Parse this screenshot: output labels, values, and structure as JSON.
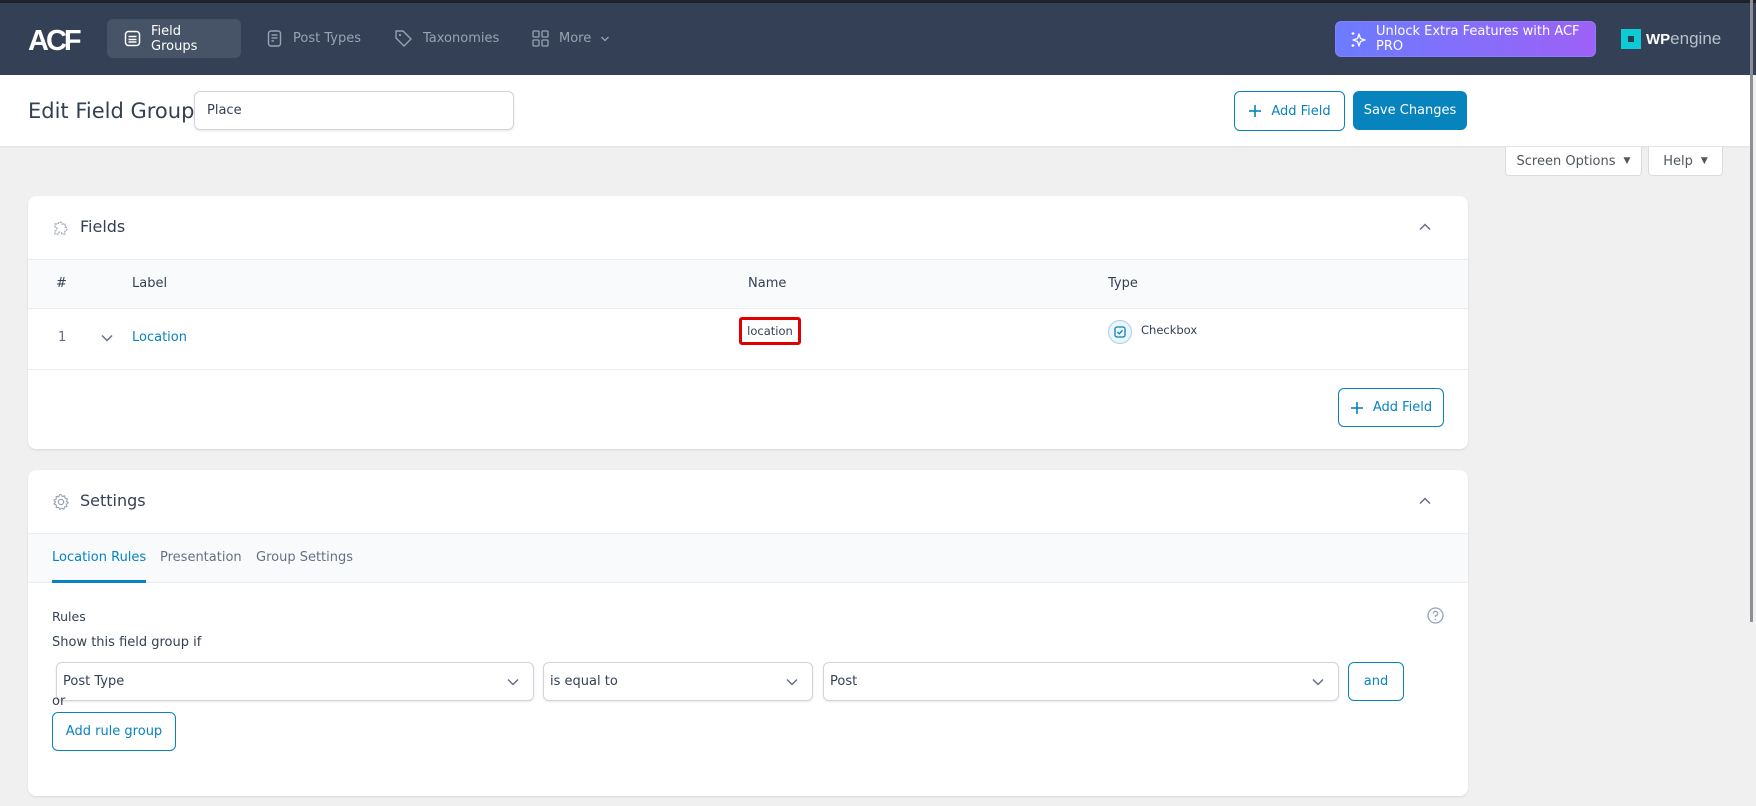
{
  "nav": {
    "logo": "ACF",
    "items": [
      {
        "label": "Field Groups",
        "icon": "field-groups-icon",
        "active": true
      },
      {
        "label": "Post Types",
        "icon": "post-types-icon",
        "active": false
      },
      {
        "label": "Taxonomies",
        "icon": "tag-icon",
        "active": false
      },
      {
        "label": "More",
        "icon": "grid-icon",
        "active": false
      }
    ],
    "unlock_label": "Unlock Extra Features with ACF PRO",
    "brand_wp": "WP",
    "brand_engine": "engine"
  },
  "header": {
    "title": "Edit Field Group",
    "group_name_value": "Place",
    "add_field_label": "Add Field",
    "save_label": "Save Changes"
  },
  "meta": {
    "screen_options": "Screen Options",
    "help": "Help"
  },
  "fields_panel": {
    "title": "Fields",
    "columns": {
      "num": "#",
      "label": "Label",
      "name": "Name",
      "type": "Type"
    },
    "rows": [
      {
        "num": "1",
        "label": "Location",
        "name": "location",
        "type": "Checkbox"
      }
    ],
    "add_field_label": "Add Field"
  },
  "settings_panel": {
    "title": "Settings",
    "tabs": [
      {
        "label": "Location Rules",
        "active": true
      },
      {
        "label": "Presentation",
        "active": false
      },
      {
        "label": "Group Settings",
        "active": false
      }
    ],
    "rules_label": "Rules",
    "show_if_label": "Show this field group if",
    "rule": {
      "param": "Post Type",
      "operator": "is equal to",
      "value": "Post"
    },
    "and_label": "and",
    "or_label": "or",
    "add_rule_group_label": "Add rule group"
  },
  "colors": {
    "nav_bg": "#344055",
    "primary": "#0783be",
    "highlight": "#e00000",
    "unlock_gradient_start": "#6b7cff",
    "unlock_gradient_end": "#9d61f7"
  }
}
